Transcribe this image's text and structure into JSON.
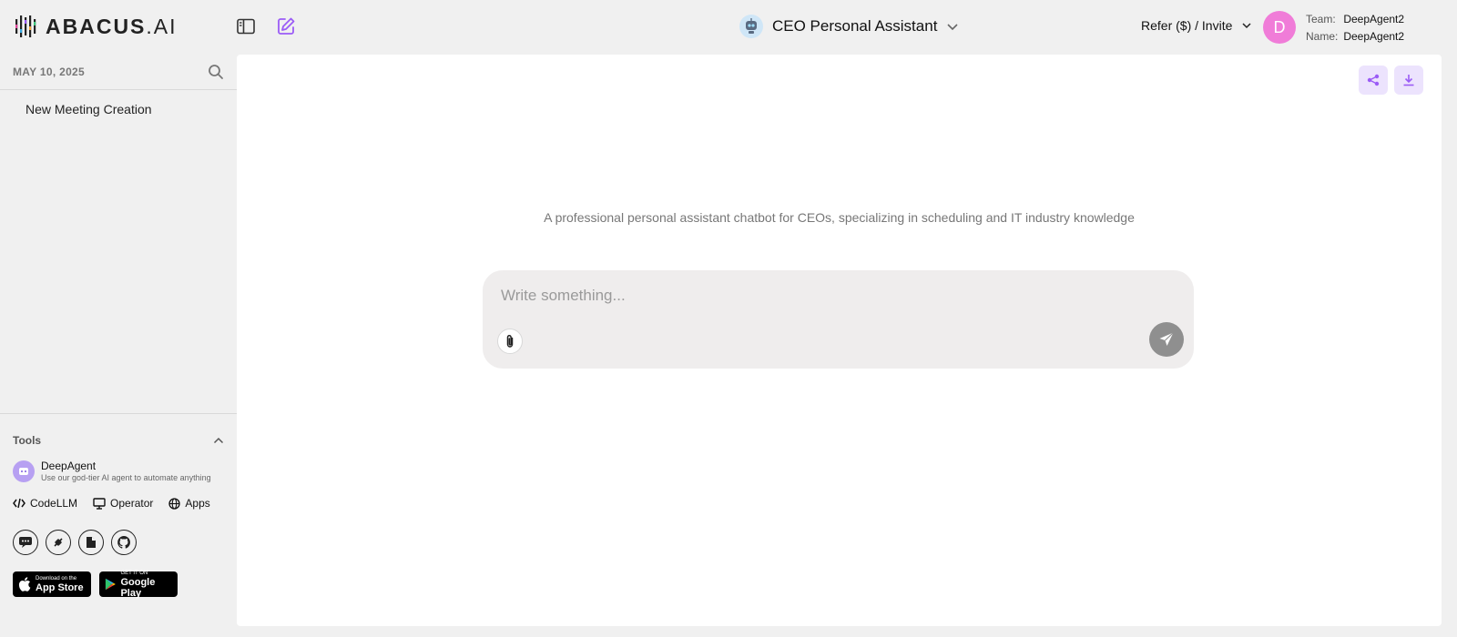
{
  "brand": {
    "logo_text": "ABACUS.AI"
  },
  "header": {
    "agent_name": "CEO Personal Assistant",
    "refer_label": "Refer ($) / Invite",
    "user_initial": "D",
    "team_label": "Team:",
    "team_value": "DeepAgent2",
    "name_label": "Name:",
    "name_value": "DeepAgent2"
  },
  "sidebar": {
    "date": "MAY 10, 2025",
    "items": [
      {
        "label": "New Meeting Creation"
      }
    ],
    "tools": {
      "title": "Tools",
      "deepagent": {
        "title": "DeepAgent",
        "subtitle": "Use our god-tier AI agent to automate anything"
      },
      "links": [
        {
          "label": "CodeLLM"
        },
        {
          "label": "Operator"
        },
        {
          "label": "Apps"
        }
      ]
    },
    "stores": {
      "apple_small": "Download on the",
      "apple_big": "App Store",
      "google_small": "GET IT ON",
      "google_big": "Google Play"
    }
  },
  "main": {
    "description": "A professional personal assistant chatbot for CEOs, specializing in scheduling and IT industry knowledge",
    "composer": {
      "placeholder": "Write something...",
      "value": ""
    }
  },
  "colors": {
    "accent": "#9b5cf6",
    "avatar": "#f07cd8",
    "corner_button_bg": "#ece3fd",
    "send_button": "#8f8f8f"
  },
  "icons": [
    "sidebar-toggle-icon",
    "new-chat-icon",
    "robot-icon",
    "chevron-down-icon",
    "search-icon",
    "chevron-up-icon",
    "code-icon",
    "monitor-icon",
    "globe-icon",
    "chat-icon",
    "plug-icon",
    "file-icon",
    "github-icon",
    "apple-icon",
    "google-play-icon",
    "share-icon",
    "download-icon",
    "paperclip-icon",
    "send-icon"
  ]
}
